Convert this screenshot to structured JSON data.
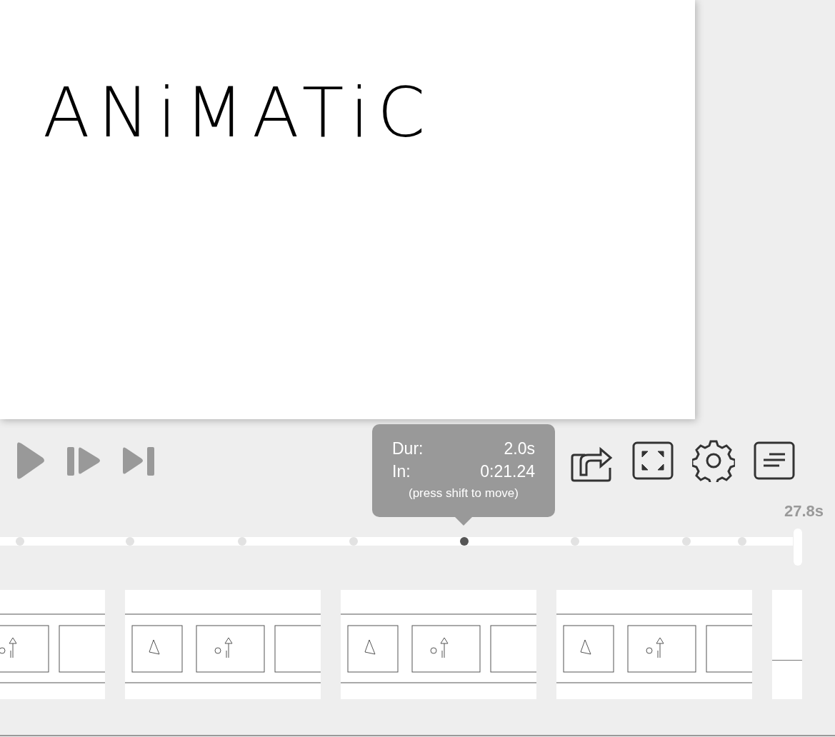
{
  "canvas": {
    "lettering": "ANiMATiC"
  },
  "tooltip": {
    "rows": [
      {
        "label": "Dur:",
        "value": "2.0s"
      },
      {
        "label": "In:",
        "value": "0:21.24"
      }
    ],
    "hint": "(press shift to move)"
  },
  "total_duration": "27.8s",
  "timeline": {
    "markers": [
      {
        "selected": false
      },
      {
        "selected": false
      },
      {
        "selected": false
      },
      {
        "selected": false
      },
      {
        "selected": true
      },
      {
        "selected": false
      },
      {
        "selected": false
      },
      {
        "selected": false
      }
    ]
  }
}
